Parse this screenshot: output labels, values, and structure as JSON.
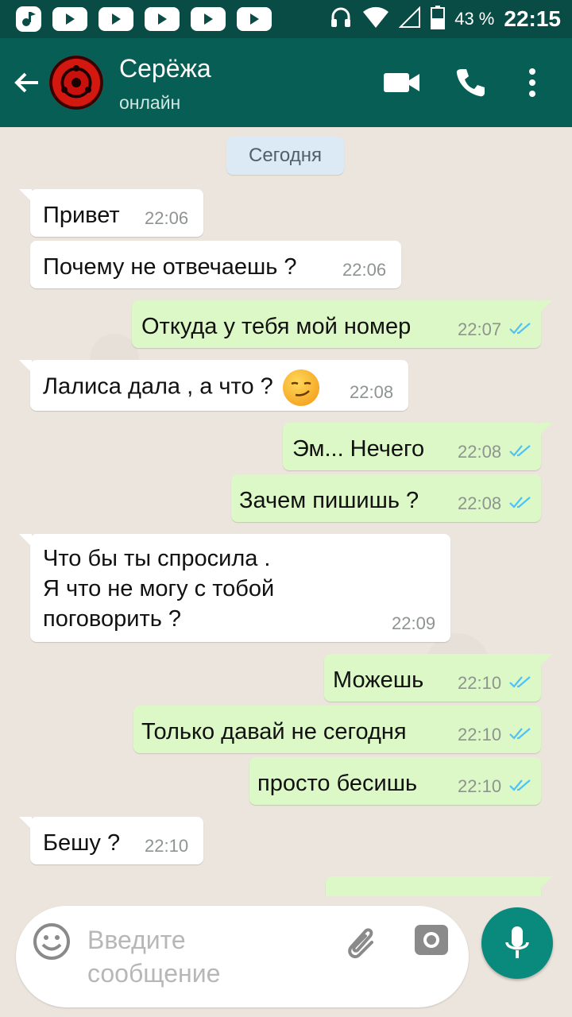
{
  "status_bar": {
    "battery": "43 %",
    "time": "22:15"
  },
  "header": {
    "contact_name": "Серёжа",
    "contact_status": "онлайн"
  },
  "chat": {
    "date_separator": "Сегодня",
    "messages": [
      {
        "direction": "in",
        "text": "Привет",
        "time": "22:06"
      },
      {
        "direction": "in",
        "text": "Почему не отвечаешь ?",
        "time": "22:06"
      },
      {
        "direction": "out",
        "text": "Откуда у тебя мой номер",
        "time": "22:07",
        "status": "read"
      },
      {
        "direction": "in",
        "text": "Лалиса дала , а что ?",
        "emoji": "smirking-face",
        "time": "22:08"
      },
      {
        "direction": "out",
        "text": "Эм... Нечего",
        "time": "22:08",
        "status": "read"
      },
      {
        "direction": "out",
        "text": "Зачем пишишь ?",
        "time": "22:08",
        "status": "read"
      },
      {
        "direction": "in",
        "text": "Что бы ты спросила .\nЯ что не могу с тобой\nпоговорить ?",
        "time": "22:09"
      },
      {
        "direction": "out",
        "text": "Можешь",
        "time": "22:10",
        "status": "read"
      },
      {
        "direction": "out",
        "text": "Только давай не сегодня",
        "time": "22:10",
        "status": "read"
      },
      {
        "direction": "out",
        "text": "просто бесишь",
        "time": "22:10",
        "status": "read"
      },
      {
        "direction": "in",
        "text": "Бешу ?",
        "time": "22:10"
      }
    ]
  },
  "composer": {
    "placeholder": "Введите\nсообщение"
  },
  "colors": {
    "header": "#075e54",
    "status_bar": "#084c45",
    "incoming_bubble": "#ffffff",
    "outgoing_bubble": "#dcf8c6",
    "read_ticks": "#4fc3f7",
    "mic_button": "#0a8a7c"
  }
}
